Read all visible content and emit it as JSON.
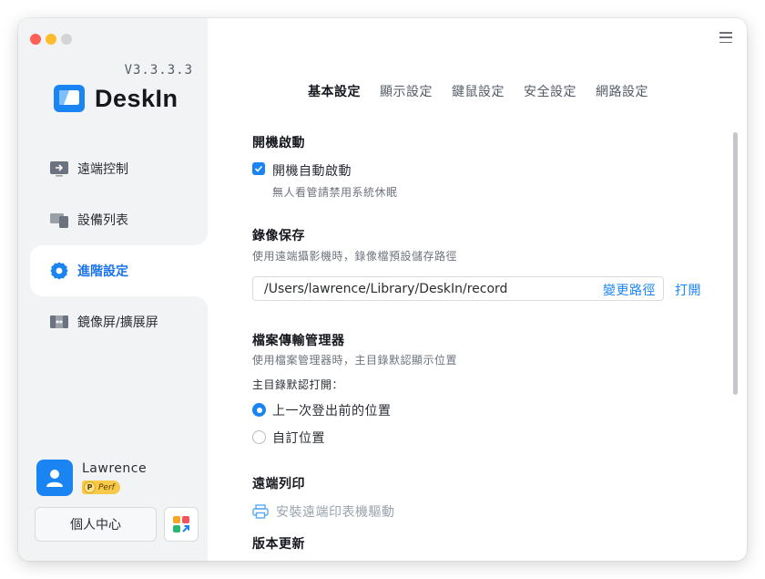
{
  "app": {
    "version": "V3.3.3.3",
    "name": "DeskIn",
    "brand_color": "#1a84f2"
  },
  "sidebar": {
    "items": [
      {
        "label": "遠端控制",
        "icon": "remote-control-icon"
      },
      {
        "label": "設備列表",
        "icon": "device-list-icon"
      },
      {
        "label": "進階設定",
        "icon": "settings-gear-icon",
        "active": true
      },
      {
        "label": "鏡像屏/擴展屏",
        "icon": "mirror-screen-icon"
      }
    ],
    "user": {
      "name": "Lawrence",
      "badge_letter": "P",
      "badge_text": "Perf"
    },
    "profile_button": "個人中心"
  },
  "tabs": [
    {
      "label": "基本設定",
      "active": true
    },
    {
      "label": "顯示設定"
    },
    {
      "label": "鍵鼠設定"
    },
    {
      "label": "安全設定"
    },
    {
      "label": "網路設定"
    }
  ],
  "startup": {
    "title": "開機啟動",
    "checkbox_label": "開機自動啟動",
    "checked": true,
    "hint": "無人看管請禁用系統休眠"
  },
  "recording": {
    "title": "錄像保存",
    "desc": "使用遠端攝影機時，錄像檔預設儲存路徑",
    "path": "/Users/lawrence/Library/DeskIn/record",
    "change_path": "變更路徑",
    "open": "打開"
  },
  "file_manager": {
    "title": "檔案傳輸管理器",
    "desc": "使用檔案管理器時，主目錄默認顯示位置",
    "default_label": "主目錄默認打開：",
    "options": [
      {
        "label": "上一次登出前的位置",
        "selected": true
      },
      {
        "label": "自訂位置",
        "selected": false
      }
    ]
  },
  "printing": {
    "title": "遠端列印",
    "install_driver": "安裝遠端印表機驅動"
  },
  "update": {
    "title": "版本更新"
  }
}
